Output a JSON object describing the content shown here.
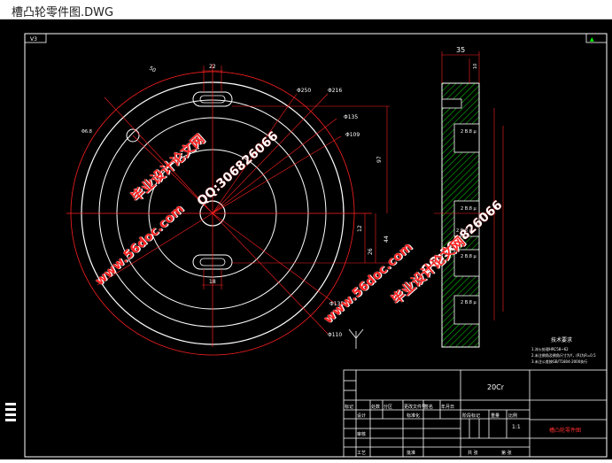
{
  "window": {
    "title": "槽凸轮零件图.DWG"
  },
  "drawing": {
    "frame_tag": "V3",
    "dims": {
      "d250": "Φ250",
      "d216": "Φ216",
      "d135a": "Φ135",
      "d109": "Φ109",
      "d135b": "Φ135",
      "d110": "Φ110",
      "v22": "22",
      "v18": "18",
      "v97": "97",
      "v44": "44",
      "v26": "26",
      "v12": "12",
      "v50": "50",
      "small_hole": "Φ6.8",
      "w35": "35",
      "w10": "10"
    },
    "tolerances": [
      "2 B.8 μ",
      "2 B.8 μ",
      "2 B.8 μ",
      "2 B.8 μ",
      "2 B.8 μ"
    ],
    "tech_req_title": "技术要求",
    "tech_req_lines": [
      "1.淬火处理HRC58~62",
      "2.未注倒角及倒角尺寸为Y，(R)为R=0.5",
      "3.未注公差按GB/T1804-2000执行"
    ]
  },
  "title_block": {
    "material": "20Cr",
    "part_name": "槽凸轮零件图",
    "row_labels": [
      "标记",
      "设计",
      "审核",
      "工艺"
    ],
    "header_cells": [
      "处数",
      "分区",
      "更改文件号",
      "签名",
      "年月日"
    ],
    "mid_labels": [
      "标准化",
      "批准"
    ],
    "right_header": [
      "阶段标记",
      "重量",
      "比例"
    ],
    "scale": "1:1",
    "sheet_label": "共 张",
    "sheet_of": "第 张"
  },
  "watermarks": {
    "site": "www.56doc.com",
    "qq": "QQ:306826066",
    "name": "毕业设计论文网"
  }
}
